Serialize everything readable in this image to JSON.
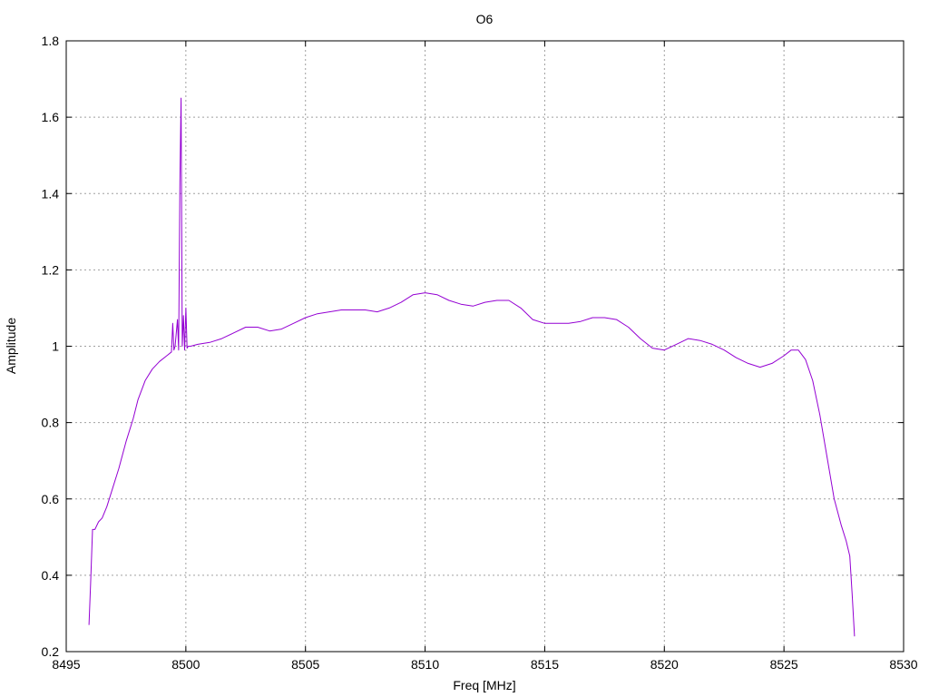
{
  "chart_data": {
    "type": "line",
    "title": "O6",
    "xlabel": "Freq [MHz]",
    "ylabel": "Amplitude",
    "xlim": [
      8495,
      8530
    ],
    "ylim": [
      0.2,
      1.8
    ],
    "grid": true,
    "x_ticks": [
      "8495",
      "8500",
      "8505",
      "8510",
      "8515",
      "8520",
      "8525",
      "8530"
    ],
    "y_ticks": [
      "0.2",
      "0.4",
      "0.6",
      "0.8",
      "1",
      "1.2",
      "1.4",
      "1.6",
      "1.8"
    ],
    "series": [
      {
        "color": "#9400d3",
        "x": [
          8495.95,
          8496.02,
          8496.1,
          8496.2,
          8496.35,
          8496.5,
          8496.7,
          8496.9,
          8497.2,
          8497.5,
          8497.8,
          8498.0,
          8498.3,
          8498.6,
          8498.9,
          8499.2,
          8499.4,
          8499.45,
          8499.5,
          8499.55,
          8499.65,
          8499.7,
          8499.75,
          8499.8,
          8499.85,
          8499.9,
          8499.95,
          8500.0,
          8500.05,
          8500.1,
          8500.2,
          8500.5,
          8501.0,
          8501.5,
          8502.0,
          8502.5,
          8503.0,
          8503.5,
          8504.0,
          8504.5,
          8505.0,
          8505.5,
          8506.0,
          8506.5,
          8507.0,
          8507.5,
          8508.0,
          8508.5,
          8509.0,
          8509.5,
          8510.0,
          8510.5,
          8511.0,
          8511.5,
          8512.0,
          8512.5,
          8513.0,
          8513.5,
          8514.0,
          8514.5,
          8515.0,
          8515.5,
          8516.0,
          8516.5,
          8517.0,
          8517.5,
          8518.0,
          8518.5,
          8519.0,
          8519.5,
          8520.0,
          8520.5,
          8521.0,
          8521.5,
          8522.0,
          8522.5,
          8523.0,
          8523.5,
          8524.0,
          8524.5,
          8525.0,
          8525.3,
          8525.6,
          8525.9,
          8526.2,
          8526.5,
          8526.8,
          8527.1,
          8527.4,
          8527.6,
          8527.75,
          8527.85,
          8527.95
        ],
        "y": [
          0.27,
          0.38,
          0.52,
          0.52,
          0.54,
          0.55,
          0.58,
          0.62,
          0.68,
          0.75,
          0.81,
          0.86,
          0.91,
          0.94,
          0.96,
          0.975,
          0.985,
          1.06,
          0.99,
          1.0,
          1.07,
          0.99,
          1.43,
          1.65,
          1.0,
          1.08,
          0.99,
          1.1,
          0.995,
          1.0,
          1.0,
          1.005,
          1.01,
          1.02,
          1.035,
          1.05,
          1.05,
          1.04,
          1.045,
          1.06,
          1.075,
          1.085,
          1.09,
          1.095,
          1.095,
          1.095,
          1.09,
          1.1,
          1.115,
          1.135,
          1.14,
          1.135,
          1.12,
          1.11,
          1.105,
          1.115,
          1.12,
          1.12,
          1.1,
          1.07,
          1.06,
          1.06,
          1.06,
          1.065,
          1.075,
          1.075,
          1.07,
          1.05,
          1.02,
          0.995,
          0.99,
          1.005,
          1.02,
          1.015,
          1.005,
          0.99,
          0.97,
          0.955,
          0.945,
          0.955,
          0.975,
          0.99,
          0.99,
          0.965,
          0.91,
          0.82,
          0.71,
          0.6,
          0.53,
          0.49,
          0.45,
          0.35,
          0.24
        ]
      }
    ]
  }
}
